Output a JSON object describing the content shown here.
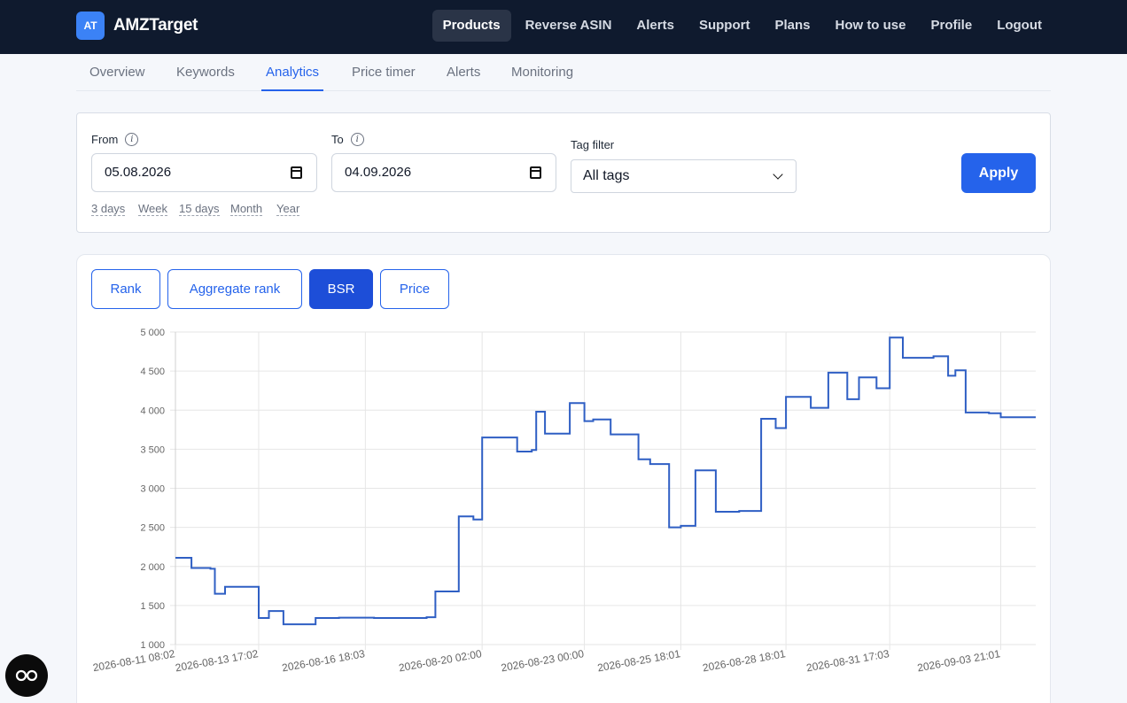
{
  "brand": {
    "badge": "AT",
    "name": "AMZTarget"
  },
  "nav": [
    "Products",
    "Reverse ASIN",
    "Alerts",
    "Support",
    "Plans",
    "How to use",
    "Profile",
    "Logout"
  ],
  "nav_active": "Products",
  "subtabs": [
    "Overview",
    "Keywords",
    "Analytics",
    "Price timer",
    "Alerts",
    "Monitoring"
  ],
  "subtab_active": "Analytics",
  "filter": {
    "from_label": "From",
    "to_label": "To",
    "from_value": "05.08.2026",
    "to_value": "04.09.2026",
    "tag_label": "Tag filter",
    "tag_value": "All tags",
    "apply": "Apply",
    "quick": [
      "3 days",
      "Week",
      "15 days",
      "Month",
      "Year"
    ]
  },
  "metric_tabs": [
    "Rank",
    "Aggregate rank",
    "BSR",
    "Price"
  ],
  "metric_active": "BSR",
  "colors": {
    "nav_bg": "#0f1a2e",
    "accent": "#2563eb",
    "line": "#2f5fc4"
  },
  "chart_data": {
    "type": "line",
    "step": true,
    "ylim": [
      1000,
      5000
    ],
    "yticks": [
      1000,
      1500,
      2000,
      2500,
      3000,
      3500,
      4000,
      4500,
      5000
    ],
    "xticks": [
      "2026-08-11 08:02",
      "2026-08-13 17:02",
      "2026-08-16 18:03",
      "2026-08-20 02:00",
      "2026-08-23 00:00",
      "2026-08-25 18:01",
      "2026-08-28 18:01",
      "2026-08-31 17:03",
      "2026-09-03 21:01"
    ],
    "xlim": [
      "2026-08-11 08:02",
      "2026-09-04 21:00"
    ],
    "grid": true,
    "points": [
      [
        "2026-08-11 08:02",
        2110
      ],
      [
        "2026-08-11 19:00",
        1980
      ],
      [
        "2026-08-12 08:00",
        1970
      ],
      [
        "2026-08-12 11:00",
        1650
      ],
      [
        "2026-08-12 18:00",
        1740
      ],
      [
        "2026-08-13 17:02",
        1340
      ],
      [
        "2026-08-14 00:00",
        1430
      ],
      [
        "2026-08-14 10:00",
        1260
      ],
      [
        "2026-08-15 08:00",
        1340
      ],
      [
        "2026-08-16 00:00",
        1345
      ],
      [
        "2026-08-17 00:00",
        1340
      ],
      [
        "2026-08-18 00:00",
        1340
      ],
      [
        "2026-08-18 12:00",
        1350
      ],
      [
        "2026-08-18 18:00",
        1680
      ],
      [
        "2026-08-19 10:00",
        2640
      ],
      [
        "2026-08-19 20:00",
        2600
      ],
      [
        "2026-08-20 02:00",
        3650
      ],
      [
        "2026-08-21 02:00",
        3470
      ],
      [
        "2026-08-21 12:00",
        3490
      ],
      [
        "2026-08-21 15:00",
        3980
      ],
      [
        "2026-08-21 21:00",
        3700
      ],
      [
        "2026-08-22 14:00",
        4090
      ],
      [
        "2026-08-23 00:00",
        3860
      ],
      [
        "2026-08-23 06:00",
        3880
      ],
      [
        "2026-08-23 18:00",
        3690
      ],
      [
        "2026-08-24 13:00",
        3370
      ],
      [
        "2026-08-24 21:00",
        3310
      ],
      [
        "2026-08-25 10:00",
        2500
      ],
      [
        "2026-08-25 18:01",
        2520
      ],
      [
        "2026-08-26 04:00",
        3230
      ],
      [
        "2026-08-26 18:00",
        2700
      ],
      [
        "2026-08-27 10:00",
        2710
      ],
      [
        "2026-08-28 01:00",
        3890
      ],
      [
        "2026-08-28 11:00",
        3770
      ],
      [
        "2026-08-28 18:01",
        4170
      ],
      [
        "2026-08-29 11:00",
        4030
      ],
      [
        "2026-08-29 23:00",
        4480
      ],
      [
        "2026-08-30 12:00",
        4140
      ],
      [
        "2026-08-30 20:00",
        4420
      ],
      [
        "2026-08-31 08:00",
        4280
      ],
      [
        "2026-08-31 17:03",
        4930
      ],
      [
        "2026-09-01 02:00",
        4670
      ],
      [
        "2026-09-01 23:00",
        4690
      ],
      [
        "2026-09-02 09:00",
        4440
      ],
      [
        "2026-09-02 14:00",
        4510
      ],
      [
        "2026-09-02 21:00",
        3970
      ],
      [
        "2026-09-03 13:00",
        3960
      ],
      [
        "2026-09-03 21:01",
        3910
      ],
      [
        "2026-09-04 21:00",
        3910
      ]
    ]
  }
}
